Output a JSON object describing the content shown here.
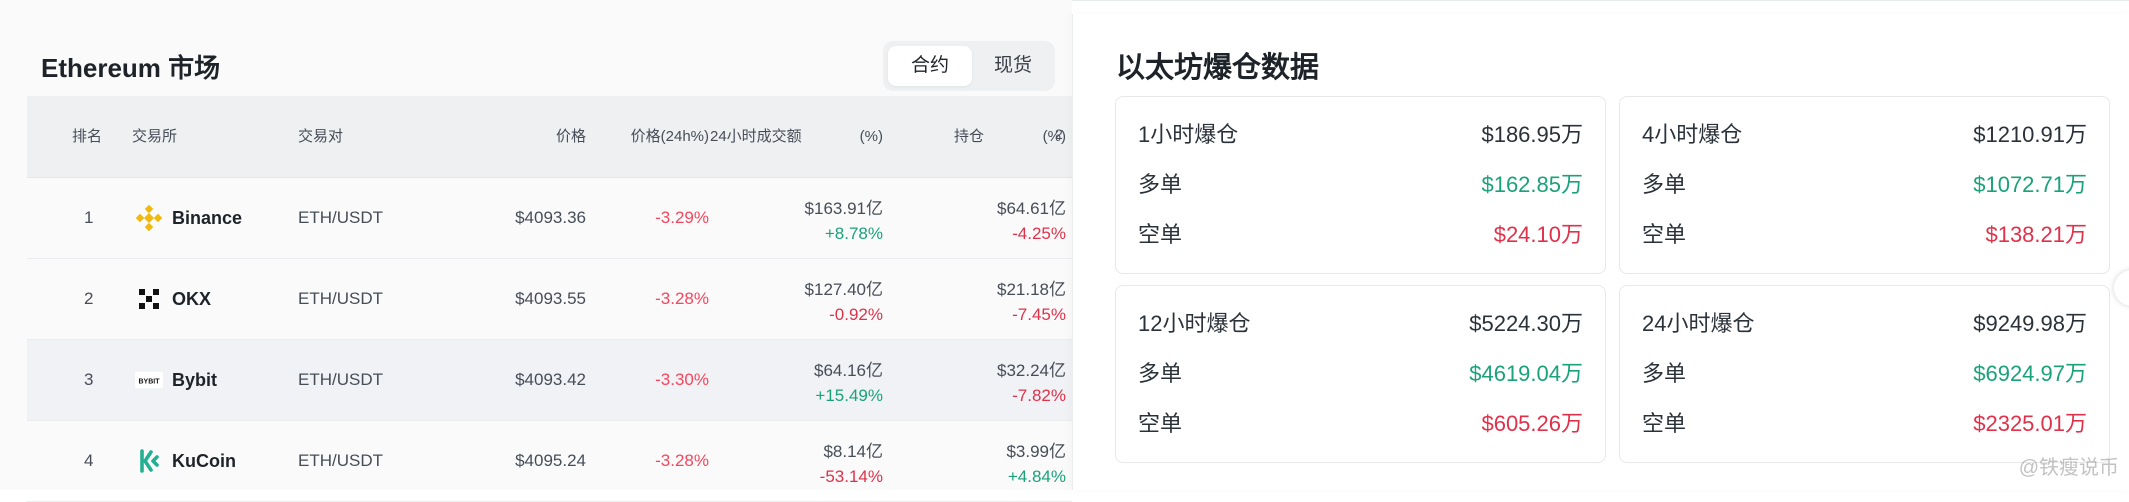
{
  "market": {
    "title": "Ethereum 市场",
    "toggle": {
      "contract": "合约",
      "spot": "现货"
    },
    "headers": {
      "rank": "排名",
      "exchange": "交易所",
      "pair": "交易对",
      "price": "价格",
      "change": "价格(24h%)",
      "volume": "24小时成交额",
      "volume_pct": "(%)",
      "oi": "持仓",
      "oi_pct": "(%)",
      "clipped": "2"
    },
    "rows": [
      {
        "rank": "1",
        "exchange": "Binance",
        "pair": "ETH/USDT",
        "price": "$4093.36",
        "change": "-3.29%",
        "volume": "$163.91亿",
        "volume_change": "+8.78%",
        "oi": "$64.61亿",
        "oi_change": "-4.25%"
      },
      {
        "rank": "2",
        "exchange": "OKX",
        "pair": "ETH/USDT",
        "price": "$4093.55",
        "change": "-3.28%",
        "volume": "$127.40亿",
        "volume_change": "-0.92%",
        "oi": "$21.18亿",
        "oi_change": "-7.45%"
      },
      {
        "rank": "3",
        "exchange": "Bybit",
        "pair": "ETH/USDT",
        "price": "$4093.42",
        "change": "-3.30%",
        "volume": "$64.16亿",
        "volume_change": "+15.49%",
        "oi": "$32.24亿",
        "oi_change": "-7.82%"
      },
      {
        "rank": "4",
        "exchange": "KuCoin",
        "pair": "ETH/USDT",
        "price": "$4095.24",
        "change": "-3.28%",
        "volume": "$8.14亿",
        "volume_change": "-53.14%",
        "oi": "$3.99亿",
        "oi_change": "+4.84%"
      }
    ],
    "logo_text": {
      "bybit": "BYBIT"
    }
  },
  "liquidation": {
    "title": "以太坊爆仓数据",
    "cards": [
      {
        "period": "1小时爆仓",
        "total": "$186.95万",
        "long_label": "多单",
        "long": "$162.85万",
        "short_label": "空单",
        "short": "$24.10万"
      },
      {
        "period": "4小时爆仓",
        "total": "$1210.91万",
        "long_label": "多单",
        "long": "$1072.71万",
        "short_label": "空单",
        "short": "$138.21万"
      },
      {
        "period": "12小时爆仓",
        "total": "$5224.30万",
        "long_label": "多单",
        "long": "$4619.04万",
        "short_label": "空单",
        "short": "$605.26万"
      },
      {
        "period": "24小时爆仓",
        "total": "$9249.98万",
        "long_label": "多单",
        "long": "$6924.97万",
        "short_label": "空单",
        "short": "$2325.01万"
      }
    ]
  },
  "watermark": "@铁瘦说币",
  "colors": {
    "up": "#1aa27a",
    "down": "#e0314b",
    "binance": "#f0b90b",
    "kucoin": "#23af91"
  }
}
